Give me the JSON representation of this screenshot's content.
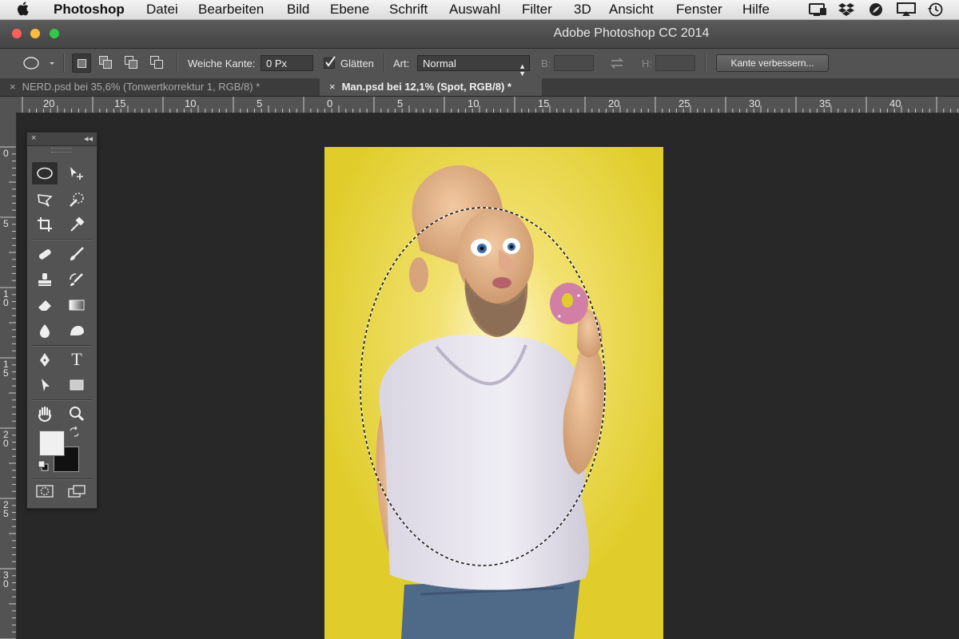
{
  "menubar": {
    "apple_icon": "apple-icon",
    "app_name": "Photoshop",
    "items": [
      "Datei",
      "Bearbeiten",
      "Bild",
      "Ebene",
      "Schrift",
      "Auswahl",
      "Filter",
      "3D",
      "Ansicht",
      "Fenster",
      "Hilfe"
    ],
    "tray_icons": [
      "display-icon",
      "dropbox-icon",
      "leaf-icon",
      "airplay-icon",
      "time-machine-icon"
    ]
  },
  "window": {
    "title": "Adobe Photoshop CC 2014",
    "traffic_light_colors": [
      "#fc605c",
      "#fdbc40",
      "#34c84a"
    ]
  },
  "options_bar": {
    "tool_icon": "elliptical-marquee-icon",
    "feather_label": "Weiche Kante:",
    "feather_value": "0 Px",
    "antialias_label": "Glätten",
    "antialias_checked": true,
    "style_label": "Art:",
    "style_value": "Normal",
    "width_label": "B:",
    "height_label": "H:",
    "refine_edge_button": "Kante verbessern..."
  },
  "tabs": [
    {
      "label": "NERD.psd bei 35,6% (Tonwertkorrektur 1, RGB/8) *",
      "active": false
    },
    {
      "label": "Man.psd bei 12,1% (Spot, RGB/8) *",
      "active": true
    }
  ],
  "ruler": {
    "horizontal": [
      "20",
      "15",
      "10",
      "5",
      "0",
      "5",
      "10",
      "15",
      "20",
      "25",
      "30",
      "35",
      "40"
    ],
    "vertical": [
      [
        "0"
      ],
      [
        "5"
      ],
      [
        "1",
        "0"
      ],
      [
        "1",
        "5"
      ],
      [
        "2",
        "0"
      ],
      [
        "2",
        "5"
      ],
      [
        "3",
        "0"
      ]
    ]
  },
  "colors": {
    "document_background": "#e0cd2c",
    "foreground_color": "#f0f0f0",
    "background_color": "#111111",
    "ui_panel": "#535353"
  },
  "toolbox": {
    "tools": [
      "elliptical-marquee-icon",
      "move-icon",
      "polygonal-lasso-icon",
      "quick-selection-icon",
      "crop-icon",
      "eyedropper-icon",
      "spot-healing-icon",
      "brush-icon",
      "clone-stamp-icon",
      "history-brush-icon",
      "eraser-icon",
      "gradient-icon",
      "blur-icon",
      "dodge-icon",
      "pen-icon",
      "type-icon",
      "path-selection-icon",
      "rectangle-icon",
      "hand-icon",
      "zoom-icon"
    ],
    "type_tool_glyph": "T"
  }
}
